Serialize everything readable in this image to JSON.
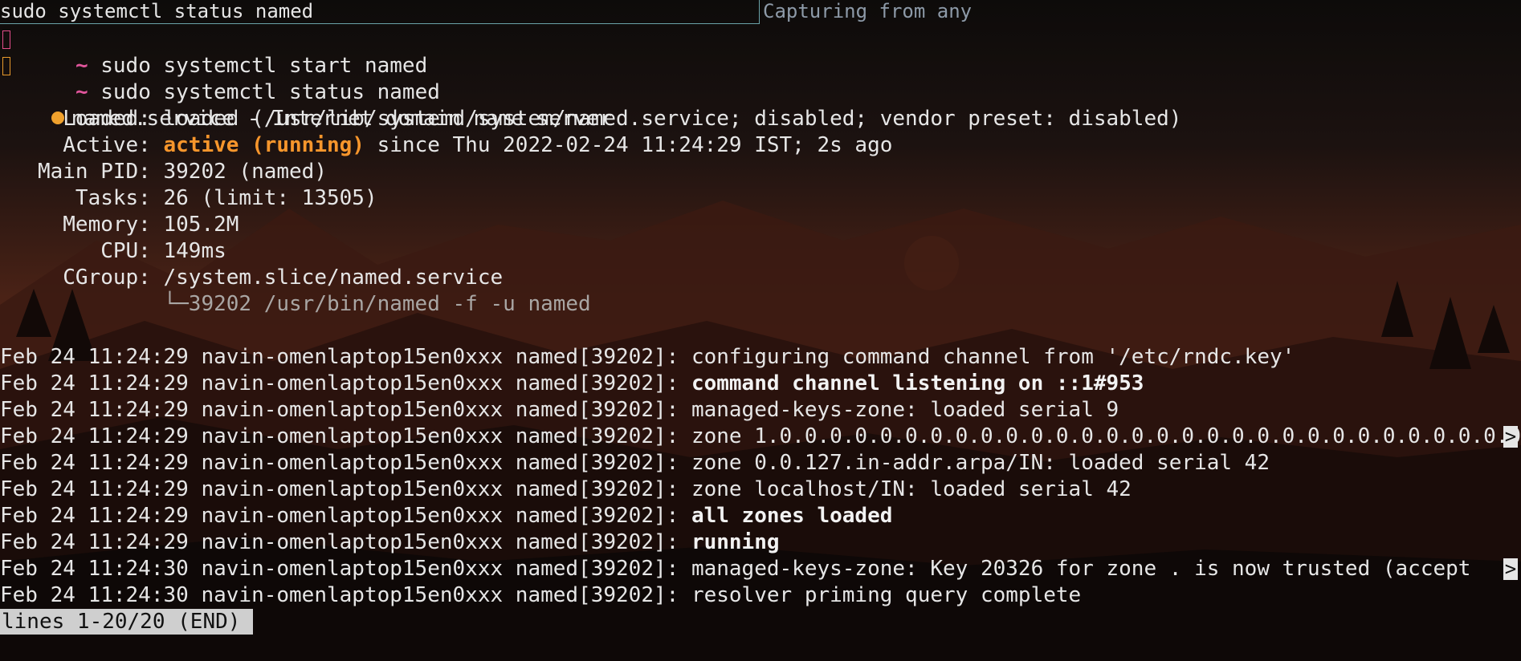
{
  "topbar": {
    "left_text": "sudo systemctl status named",
    "right_text": "Capturing from any"
  },
  "prompt": {
    "symbol": "~",
    "commands": [
      "sudo systemctl start named",
      "sudo systemctl status named"
    ]
  },
  "service": {
    "header": "named.service - Internet domain name server",
    "fields": {
      "loaded_label": "     Loaded:",
      "loaded_value": " loaded (/usr/lib/systemd/system/named.service; disabled; vendor preset: disabled)",
      "active_label": "     Active:",
      "active_state": " active (running)",
      "active_since": " since Thu 2022-02-24 11:24:29 IST; 2s ago",
      "mainpid_label": "   Main PID:",
      "mainpid_value": " 39202 (named)",
      "tasks_label": "      Tasks:",
      "tasks_value": " 26 (limit: 13505)",
      "memory_label": "     Memory:",
      "memory_value": " 105.2M",
      "cpu_label": "        CPU:",
      "cpu_value": " 149ms",
      "cgroup_label": "     CGroup:",
      "cgroup_value": " /system.slice/named.service",
      "cgroup_child": "             └─39202 /usr/bin/named -f -u named"
    }
  },
  "log": {
    "prefix_a": "Feb 24 11:24:29 navin-omenlaptop15en0xxx named[39202]: ",
    "prefix_b": "Feb 24 11:24:30 navin-omenlaptop15en0xxx named[39202]: ",
    "messages": [
      "configuring command channel from '/etc/rndc.key'",
      "command channel listening on ::1#953",
      "managed-keys-zone: loaded serial 9",
      "zone 1.0.0.0.0.0.0.0.0.0.0.0.0.0.0.0.0.0.0.0.0.0.0.0.0.0.0.0.0.0.0.0",
      "zone 0.0.127.in-addr.arpa/IN: loaded serial 42",
      "zone localhost/IN: loaded serial 42",
      "all zones loaded",
      "running",
      "managed-keys-zone: Key 20326 for zone . is now trusted (accept",
      "resolver priming query complete"
    ],
    "truncation_marker": ">"
  },
  "pager_status": "lines 1-20/20 (END)",
  "colors": {
    "prompt_symbol": "#e0559b",
    "active_state": "#f7962c",
    "status_dot": "#f0a12d",
    "tab_border": "#6aa3a8",
    "pager_bg": "#cfcfcf"
  }
}
